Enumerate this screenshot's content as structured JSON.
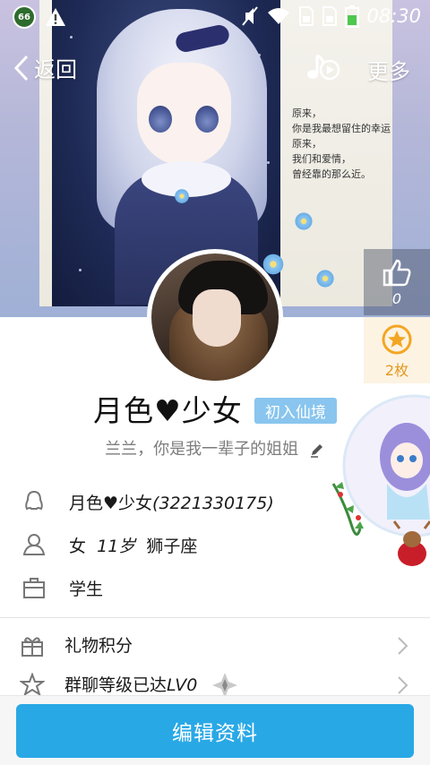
{
  "status_bar": {
    "battery_badge": "66",
    "time": "08:30"
  },
  "nav": {
    "back_label": "返回",
    "more_label": "更多"
  },
  "cover": {
    "poem_lines": [
      "原来，",
      "你是我最想留住的幸运！",
      "原来，",
      "我们和爱情，",
      "曾经靠的那么近。"
    ]
  },
  "stats": {
    "like_count": "0",
    "coin_count": "2枚"
  },
  "profile": {
    "nickname": "月色♥少女",
    "level_badge": "初入仙境",
    "signature": "兰兰，你是我一辈子的姐姐"
  },
  "info": {
    "account_name": "月色♥少女",
    "account_id": "(3221330175)",
    "gender": "女",
    "age": "11岁",
    "zodiac": "狮子座",
    "occupation": "学生"
  },
  "menu": {
    "gift_points": "礼物积分",
    "group_level_prefix": "群聊等级已达",
    "group_level_value": "LV0"
  },
  "actions": {
    "edit_profile": "编辑资料"
  },
  "colors": {
    "accent_blue": "#29a8e6",
    "badge_blue": "#89c5ee",
    "coin_orange": "#e29a22"
  }
}
